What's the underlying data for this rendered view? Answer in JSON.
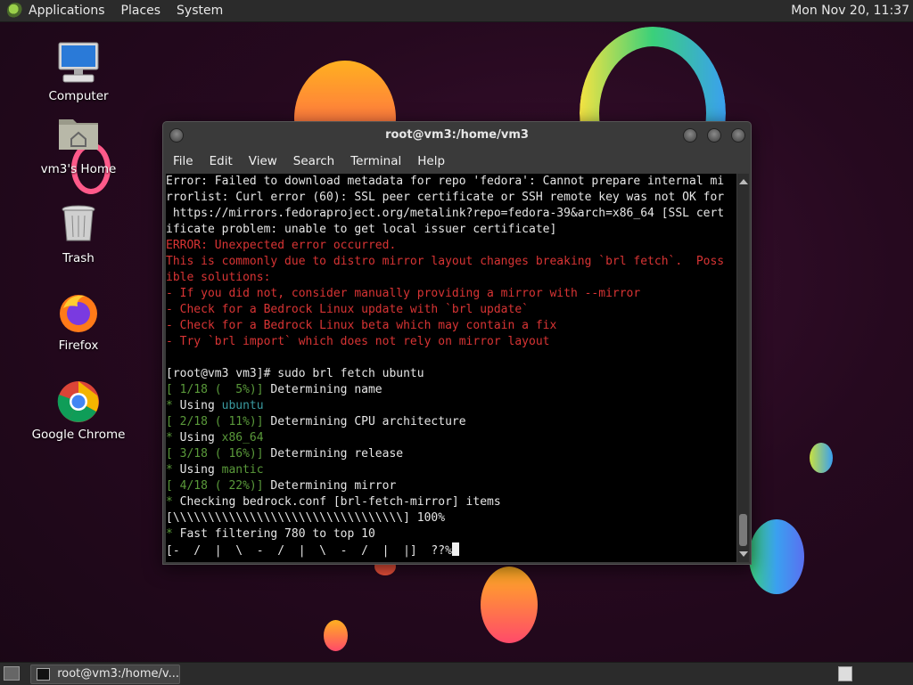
{
  "top_panel": {
    "menus": [
      "Applications",
      "Places",
      "System"
    ],
    "clock": "Mon Nov 20, 11:37"
  },
  "desktop_icons": [
    {
      "label": "Computer",
      "icon": "computer-icon"
    },
    {
      "label": "vm3's Home",
      "icon": "home-folder-icon"
    },
    {
      "label": "Trash",
      "icon": "trash-icon"
    },
    {
      "label": "Firefox",
      "icon": "firefox-icon"
    },
    {
      "label": "Google Chrome",
      "icon": "chrome-icon"
    }
  ],
  "terminal_window": {
    "title": "root@vm3:/home/vm3",
    "menu": [
      "File",
      "Edit",
      "View",
      "Search",
      "Terminal",
      "Help"
    ],
    "lines": [
      {
        "parts": [
          {
            "t": "Error: Failed to download metadata for repo 'fedora': Cannot prepare internal mi",
            "c": ""
          }
        ]
      },
      {
        "parts": [
          {
            "t": "rrorlist: Curl error (60): SSL peer certificate or SSH remote key was not OK for",
            "c": ""
          }
        ]
      },
      {
        "parts": [
          {
            "t": " https://mirrors.fedoraproject.org/metalink?repo=fedora-39&arch=x86_64 [SSL cert",
            "c": ""
          }
        ]
      },
      {
        "parts": [
          {
            "t": "ificate problem: unable to get local issuer certificate]",
            "c": ""
          }
        ]
      },
      {
        "parts": [
          {
            "t": "ERROR: Unexpected error occurred.",
            "c": "red"
          }
        ]
      },
      {
        "parts": [
          {
            "t": "This is commonly due to distro mirror layout changes breaking `brl fetch`.  Poss",
            "c": "red"
          }
        ]
      },
      {
        "parts": [
          {
            "t": "ible solutions:",
            "c": "red"
          }
        ]
      },
      {
        "parts": [
          {
            "t": "- If you did not, consider manually providing a mirror with --mirror",
            "c": "red"
          }
        ]
      },
      {
        "parts": [
          {
            "t": "- Check for a Bedrock Linux update with `brl update`",
            "c": "red"
          }
        ]
      },
      {
        "parts": [
          {
            "t": "- Check for a Bedrock Linux beta which may contain a fix",
            "c": "red"
          }
        ]
      },
      {
        "parts": [
          {
            "t": "- Try `brl import` which does not rely on mirror layout",
            "c": "red"
          }
        ]
      },
      {
        "parts": [
          {
            "t": "",
            "c": ""
          }
        ]
      },
      {
        "parts": [
          {
            "t": "[root@vm3 vm3]# sudo brl fetch ubuntu",
            "c": ""
          }
        ]
      },
      {
        "parts": [
          {
            "t": "[ 1/18 (  5%)]",
            "c": "grn"
          },
          {
            "t": " Determining name",
            "c": ""
          }
        ]
      },
      {
        "parts": [
          {
            "t": "*",
            "c": "grn"
          },
          {
            "t": " Using ",
            "c": ""
          },
          {
            "t": "ubuntu",
            "c": "cyan"
          }
        ]
      },
      {
        "parts": [
          {
            "t": "[ 2/18 ( 11%)]",
            "c": "grn"
          },
          {
            "t": " Determining CPU architecture",
            "c": ""
          }
        ]
      },
      {
        "parts": [
          {
            "t": "*",
            "c": "grn"
          },
          {
            "t": " Using ",
            "c": ""
          },
          {
            "t": "x86_64",
            "c": "grn"
          }
        ]
      },
      {
        "parts": [
          {
            "t": "[ 3/18 ( 16%)]",
            "c": "grn"
          },
          {
            "t": " Determining release",
            "c": ""
          }
        ]
      },
      {
        "parts": [
          {
            "t": "*",
            "c": "grn"
          },
          {
            "t": " Using ",
            "c": ""
          },
          {
            "t": "mantic",
            "c": "grn"
          }
        ]
      },
      {
        "parts": [
          {
            "t": "[ 4/18 ( 22%)]",
            "c": "grn"
          },
          {
            "t": " Determining mirror",
            "c": ""
          }
        ]
      },
      {
        "parts": [
          {
            "t": "*",
            "c": "grn"
          },
          {
            "t": " Checking bedrock.conf [brl-fetch-mirror] items",
            "c": ""
          }
        ]
      },
      {
        "parts": [
          {
            "t": "[\\\\\\\\\\\\\\\\\\\\\\\\\\\\\\\\\\\\\\\\\\\\\\\\\\\\\\\\\\\\\\\\\\] 100%",
            "c": ""
          }
        ]
      },
      {
        "parts": [
          {
            "t": "*",
            "c": "grn"
          },
          {
            "t": " Fast filtering 780 to top 10",
            "c": ""
          }
        ]
      },
      {
        "parts": [
          {
            "t": "[-  /  |  \\  -  /  |  \\  -  /  |  |]  ??%",
            "c": ""
          }
        ],
        "cursor": true
      }
    ]
  },
  "bottom_panel": {
    "task_label": "root@vm3:/home/v..."
  }
}
